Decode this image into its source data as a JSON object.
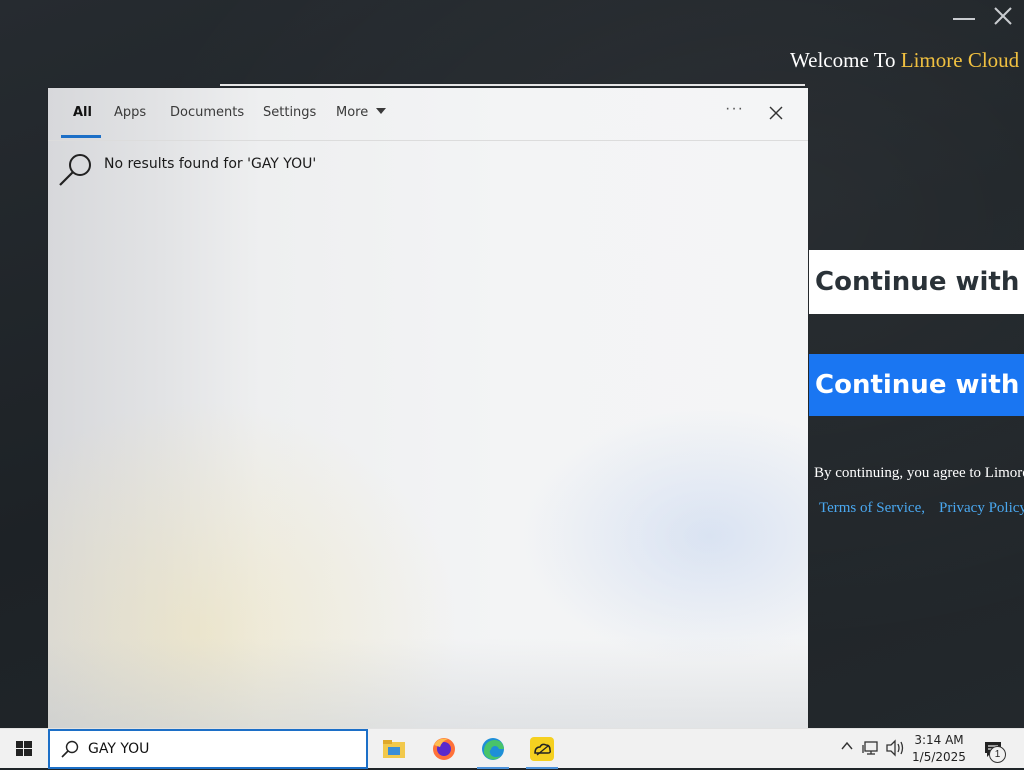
{
  "background_app": {
    "welcome_prefix": "Welcome To ",
    "welcome_brand": "Limore Cloud",
    "google_button_label": "Continue with Google",
    "facebook_button_label": "Continue with Facebook",
    "agree_text": "By continuing, you agree to Limore Cloud's",
    "terms_link": "Terms of Service,",
    "privacy_link": "Privacy Policy",
    "colors": {
      "brand": "#f0c040",
      "facebook": "#1a76f2",
      "link": "#4aa8f0"
    }
  },
  "search_panel": {
    "tabs": [
      {
        "label": "All",
        "selected": true
      },
      {
        "label": "Apps"
      },
      {
        "label": "Documents"
      },
      {
        "label": "Settings"
      },
      {
        "label": "More"
      }
    ],
    "more_options_glyph": "···",
    "result_message": "No results found for 'GAY YOU'"
  },
  "taskbar": {
    "search_value": "GAY YOU",
    "apps": [
      {
        "icon": "file-explorer-icon"
      },
      {
        "icon": "firefox-icon"
      },
      {
        "icon": "edge-icon",
        "active": true
      },
      {
        "icon": "limore-cloud-icon",
        "active": true
      }
    ],
    "clock_time": "3:14 AM",
    "clock_date": "1/5/2025",
    "notification_count": "1",
    "accent": "#1c6fc7"
  }
}
